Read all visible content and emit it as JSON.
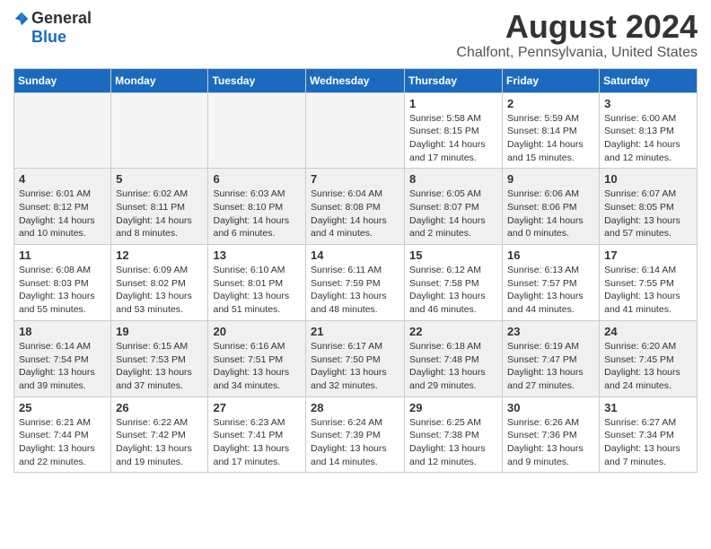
{
  "header": {
    "logo_general": "General",
    "logo_blue": "Blue",
    "month_title": "August 2024",
    "location": "Chalfont, Pennsylvania, United States"
  },
  "days_of_week": [
    "Sunday",
    "Monday",
    "Tuesday",
    "Wednesday",
    "Thursday",
    "Friday",
    "Saturday"
  ],
  "weeks": [
    {
      "shaded": false,
      "days": [
        {
          "num": "",
          "info": ""
        },
        {
          "num": "",
          "info": ""
        },
        {
          "num": "",
          "info": ""
        },
        {
          "num": "",
          "info": ""
        },
        {
          "num": "1",
          "info": "Sunrise: 5:58 AM\nSunset: 8:15 PM\nDaylight: 14 hours and 17 minutes."
        },
        {
          "num": "2",
          "info": "Sunrise: 5:59 AM\nSunset: 8:14 PM\nDaylight: 14 hours and 15 minutes."
        },
        {
          "num": "3",
          "info": "Sunrise: 6:00 AM\nSunset: 8:13 PM\nDaylight: 14 hours and 12 minutes."
        }
      ]
    },
    {
      "shaded": true,
      "days": [
        {
          "num": "4",
          "info": "Sunrise: 6:01 AM\nSunset: 8:12 PM\nDaylight: 14 hours and 10 minutes."
        },
        {
          "num": "5",
          "info": "Sunrise: 6:02 AM\nSunset: 8:11 PM\nDaylight: 14 hours and 8 minutes."
        },
        {
          "num": "6",
          "info": "Sunrise: 6:03 AM\nSunset: 8:10 PM\nDaylight: 14 hours and 6 minutes."
        },
        {
          "num": "7",
          "info": "Sunrise: 6:04 AM\nSunset: 8:08 PM\nDaylight: 14 hours and 4 minutes."
        },
        {
          "num": "8",
          "info": "Sunrise: 6:05 AM\nSunset: 8:07 PM\nDaylight: 14 hours and 2 minutes."
        },
        {
          "num": "9",
          "info": "Sunrise: 6:06 AM\nSunset: 8:06 PM\nDaylight: 14 hours and 0 minutes."
        },
        {
          "num": "10",
          "info": "Sunrise: 6:07 AM\nSunset: 8:05 PM\nDaylight: 13 hours and 57 minutes."
        }
      ]
    },
    {
      "shaded": false,
      "days": [
        {
          "num": "11",
          "info": "Sunrise: 6:08 AM\nSunset: 8:03 PM\nDaylight: 13 hours and 55 minutes."
        },
        {
          "num": "12",
          "info": "Sunrise: 6:09 AM\nSunset: 8:02 PM\nDaylight: 13 hours and 53 minutes."
        },
        {
          "num": "13",
          "info": "Sunrise: 6:10 AM\nSunset: 8:01 PM\nDaylight: 13 hours and 51 minutes."
        },
        {
          "num": "14",
          "info": "Sunrise: 6:11 AM\nSunset: 7:59 PM\nDaylight: 13 hours and 48 minutes."
        },
        {
          "num": "15",
          "info": "Sunrise: 6:12 AM\nSunset: 7:58 PM\nDaylight: 13 hours and 46 minutes."
        },
        {
          "num": "16",
          "info": "Sunrise: 6:13 AM\nSunset: 7:57 PM\nDaylight: 13 hours and 44 minutes."
        },
        {
          "num": "17",
          "info": "Sunrise: 6:14 AM\nSunset: 7:55 PM\nDaylight: 13 hours and 41 minutes."
        }
      ]
    },
    {
      "shaded": true,
      "days": [
        {
          "num": "18",
          "info": "Sunrise: 6:14 AM\nSunset: 7:54 PM\nDaylight: 13 hours and 39 minutes."
        },
        {
          "num": "19",
          "info": "Sunrise: 6:15 AM\nSunset: 7:53 PM\nDaylight: 13 hours and 37 minutes."
        },
        {
          "num": "20",
          "info": "Sunrise: 6:16 AM\nSunset: 7:51 PM\nDaylight: 13 hours and 34 minutes."
        },
        {
          "num": "21",
          "info": "Sunrise: 6:17 AM\nSunset: 7:50 PM\nDaylight: 13 hours and 32 minutes."
        },
        {
          "num": "22",
          "info": "Sunrise: 6:18 AM\nSunset: 7:48 PM\nDaylight: 13 hours and 29 minutes."
        },
        {
          "num": "23",
          "info": "Sunrise: 6:19 AM\nSunset: 7:47 PM\nDaylight: 13 hours and 27 minutes."
        },
        {
          "num": "24",
          "info": "Sunrise: 6:20 AM\nSunset: 7:45 PM\nDaylight: 13 hours and 24 minutes."
        }
      ]
    },
    {
      "shaded": false,
      "days": [
        {
          "num": "25",
          "info": "Sunrise: 6:21 AM\nSunset: 7:44 PM\nDaylight: 13 hours and 22 minutes."
        },
        {
          "num": "26",
          "info": "Sunrise: 6:22 AM\nSunset: 7:42 PM\nDaylight: 13 hours and 19 minutes."
        },
        {
          "num": "27",
          "info": "Sunrise: 6:23 AM\nSunset: 7:41 PM\nDaylight: 13 hours and 17 minutes."
        },
        {
          "num": "28",
          "info": "Sunrise: 6:24 AM\nSunset: 7:39 PM\nDaylight: 13 hours and 14 minutes."
        },
        {
          "num": "29",
          "info": "Sunrise: 6:25 AM\nSunset: 7:38 PM\nDaylight: 13 hours and 12 minutes."
        },
        {
          "num": "30",
          "info": "Sunrise: 6:26 AM\nSunset: 7:36 PM\nDaylight: 13 hours and 9 minutes."
        },
        {
          "num": "31",
          "info": "Sunrise: 6:27 AM\nSunset: 7:34 PM\nDaylight: 13 hours and 7 minutes."
        }
      ]
    }
  ]
}
